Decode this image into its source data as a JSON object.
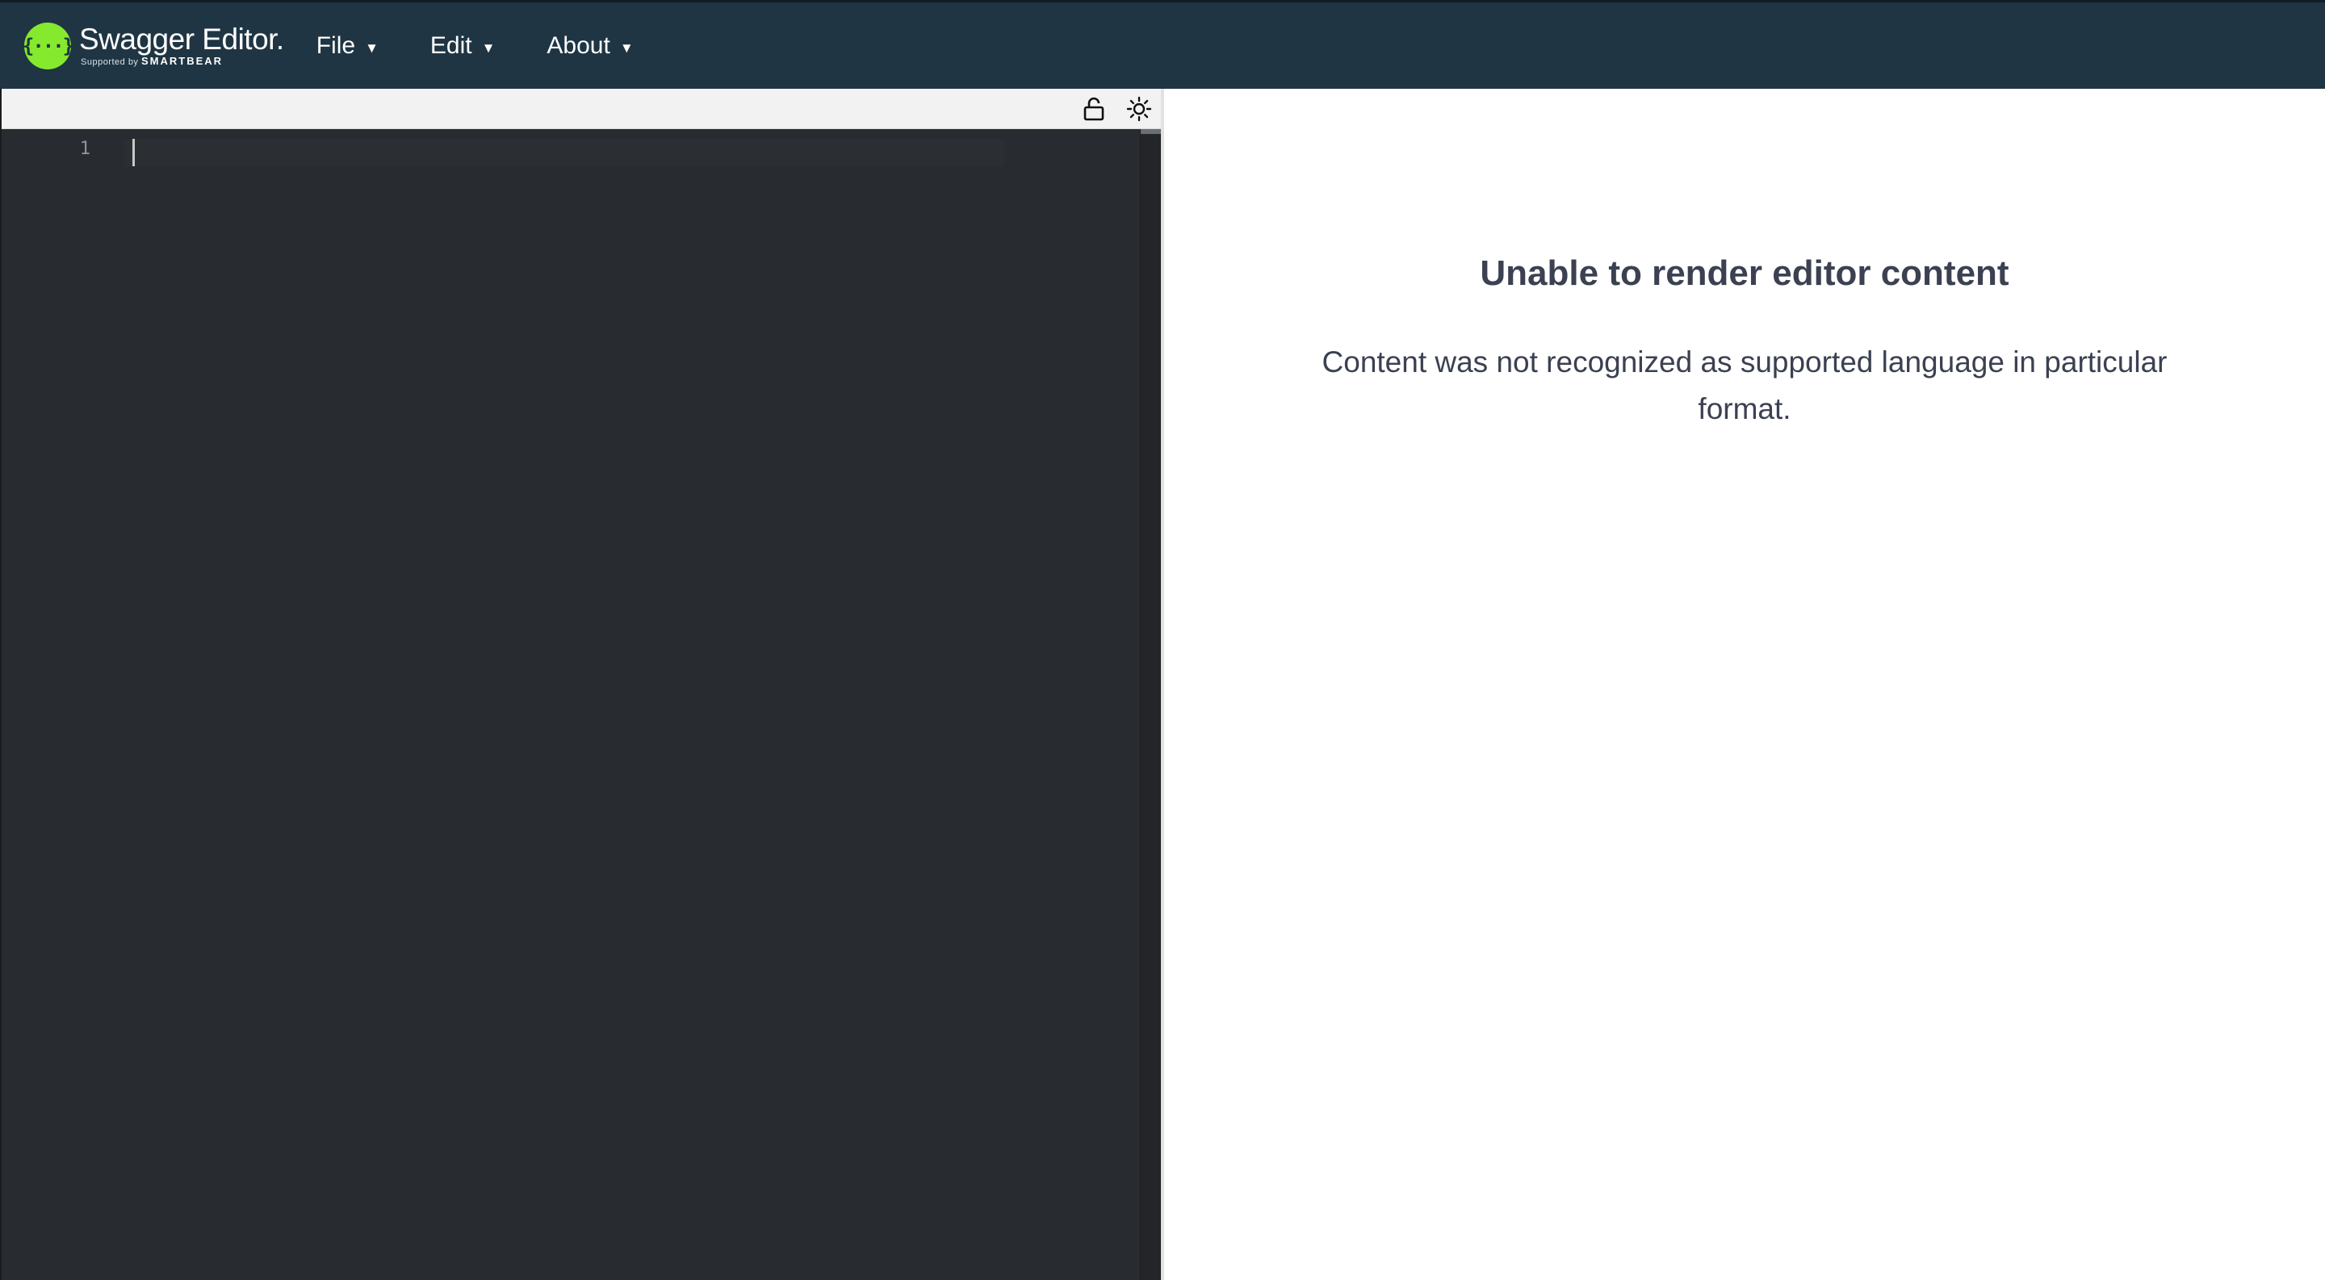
{
  "header": {
    "logo_symbol": "{···}",
    "app_title": "Swagger Editor.",
    "supported_by": "Supported by",
    "brand": "SMARTBEAR",
    "brand_color": "#85ea2d",
    "background_color": "#1f3543"
  },
  "menu": {
    "items": [
      {
        "label": "File",
        "caret": "▼"
      },
      {
        "label": "Edit",
        "caret": "▼"
      },
      {
        "label": "About",
        "caret": "▼"
      }
    ]
  },
  "editor": {
    "toolbar": {
      "lock_icon": "unlock-icon",
      "theme_icon": "sun-icon"
    },
    "line_numbers": [
      "1"
    ],
    "content": "",
    "background_color": "#282b2f"
  },
  "preview": {
    "title": "Unable to render editor content",
    "message": "Content was not recognized as supported language in particular format.",
    "text_color": "#3b4151"
  }
}
